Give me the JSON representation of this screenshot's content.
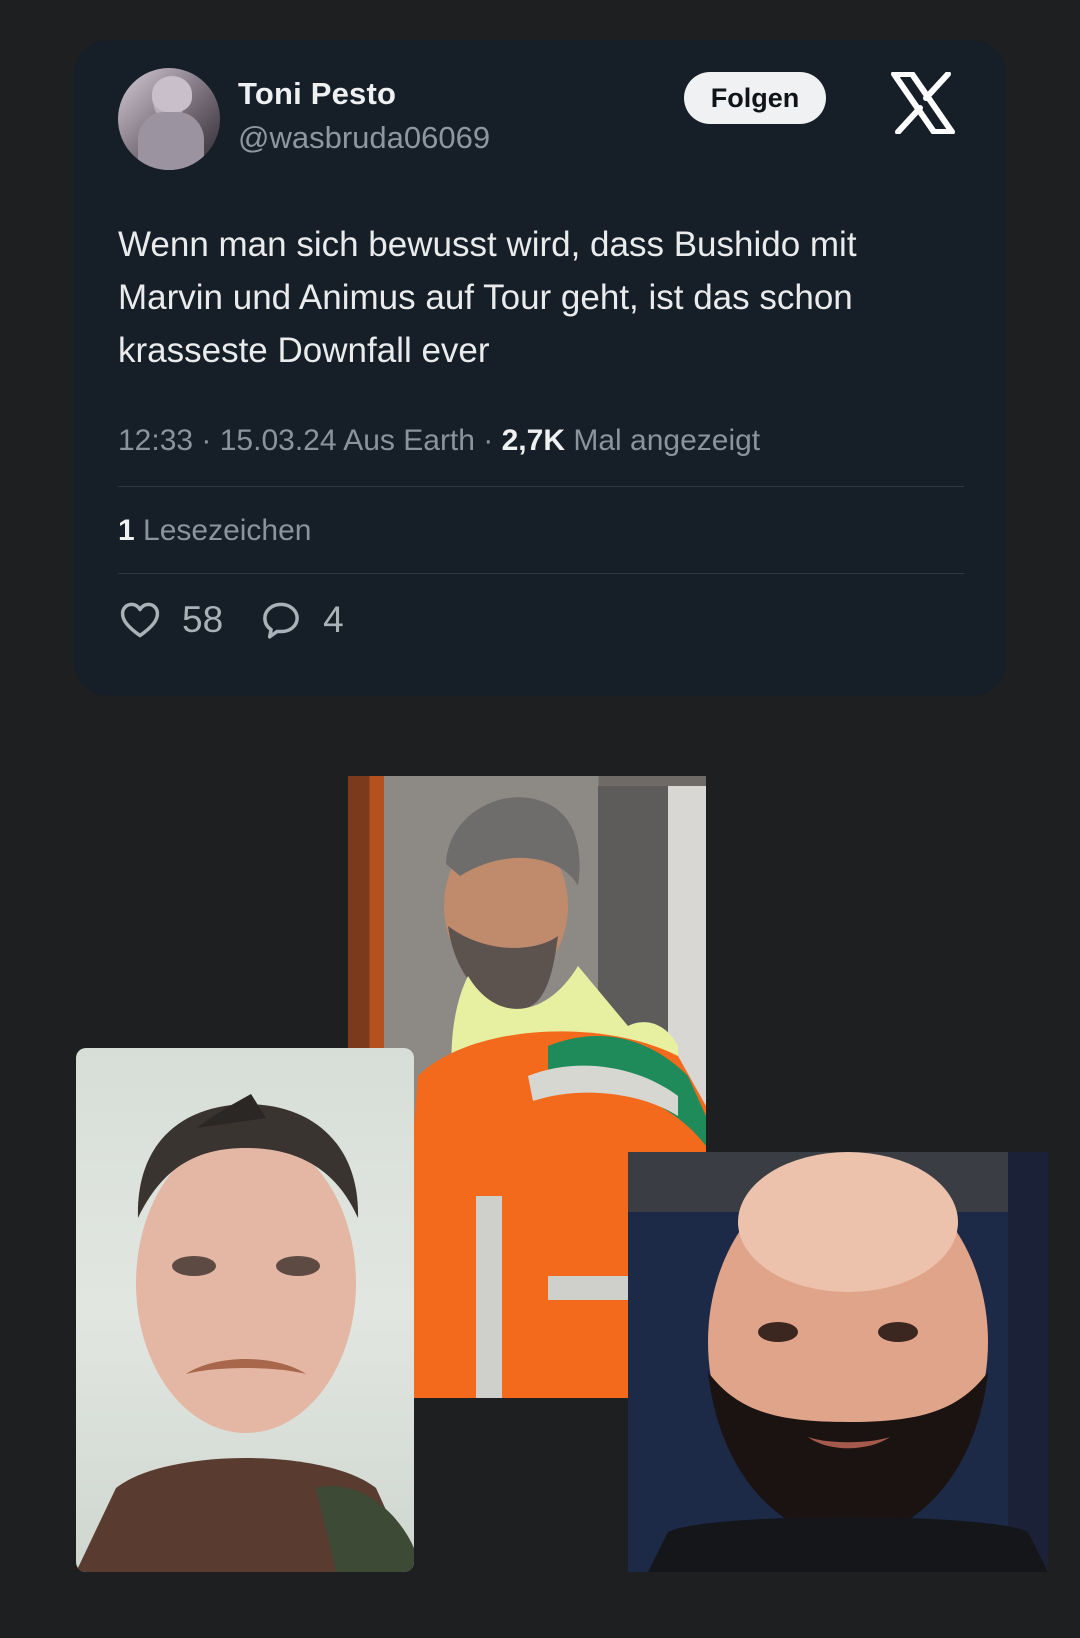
{
  "tweet": {
    "author": {
      "display_name": "Toni Pesto",
      "handle": "@wasbruda06069"
    },
    "follow_label": "Folgen",
    "brand_icon": "x-logo-icon",
    "text": "Wenn man sich bewusst wird, dass Bushido mit Marvin und Animus auf Tour geht, ist das schon krasseste Downfall ever",
    "meta": {
      "time": "12:33",
      "date": "15.03.24",
      "location": "Aus Earth",
      "views_count": "2,7K",
      "views_label": "Mal angezeigt"
    },
    "bookmarks": {
      "count": "1",
      "label": "Lesezeichen"
    },
    "likes": "58",
    "replies": "4"
  },
  "colors": {
    "page_background": "#1e1f21",
    "card_background": "#161e27",
    "muted_text": "#8a949c",
    "primary_text": "#e9ebec",
    "follow_button": "#eff1f2"
  },
  "photos": [
    {
      "description_icon": "photo-man-orange-jacket"
    },
    {
      "description_icon": "photo-man-mustache"
    },
    {
      "description_icon": "photo-man-bald-beard"
    }
  ]
}
